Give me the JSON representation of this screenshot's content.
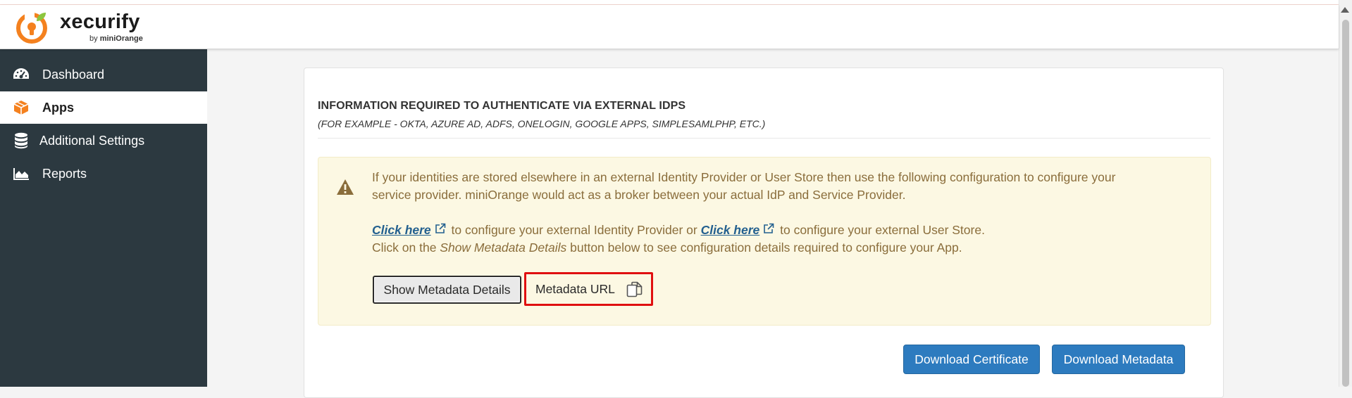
{
  "brand": {
    "name": "xecurify",
    "byline_prefix": "by",
    "byline_brand": "miniOrange",
    "colors": {
      "orange": "#f4811f",
      "green": "#8cc63f"
    }
  },
  "sidebar": {
    "items": [
      {
        "label": "Dashboard",
        "icon": "dashboard-gauge-icon",
        "active": false
      },
      {
        "label": "Apps",
        "icon": "cube-icon",
        "active": true
      },
      {
        "label": "Additional Settings",
        "icon": "database-icon",
        "active": false
      },
      {
        "label": "Reports",
        "icon": "area-chart-icon",
        "active": false
      }
    ]
  },
  "main": {
    "title": "INFORMATION REQUIRED TO AUTHENTICATE VIA EXTERNAL IDPS",
    "subtitle": "(FOR EXAMPLE - OKTA, AZURE AD, ADFS, ONELOGIN, GOOGLE APPS, SIMPLESAMLPHP, ETC.)",
    "alert": {
      "line1": "If your identities are stored elsewhere in an external Identity Provider or User Store then use the following configuration to configure your",
      "line2": "service provider. miniOrange would act as a broker between your actual IdP and Service Provider.",
      "link1": "Click here",
      "text_after_link1": " to configure your external Identity Provider or ",
      "link2": "Click here",
      "text_after_link2": " to configure your external User Store.",
      "line4_prefix": "Click on the ",
      "line4_emphasis": "Show Metadata Details",
      "line4_suffix": " button below to see configuration details required to configure your App."
    },
    "show_metadata_button": "Show Metadata Details",
    "metadata_url_label": "Metadata URL",
    "download_certificate_button": "Download Certificate",
    "download_metadata_button": "Download Metadata"
  }
}
